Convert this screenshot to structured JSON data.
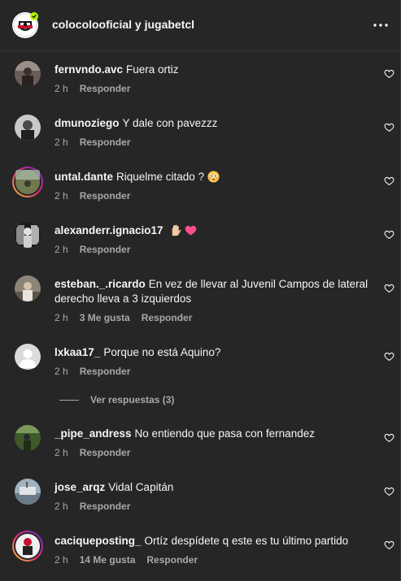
{
  "header": {
    "title": "colocolooficial y jugabetcl",
    "more_icon": "more-horizontal-icon"
  },
  "comments": [
    {
      "user": "fernvndo.avc",
      "text": "Fuera ortiz",
      "time": "2 h",
      "likes": "",
      "reply": "Responder"
    },
    {
      "user": "dmunoziego",
      "text": "Y dale con pavezzz",
      "time": "2 h",
      "likes": "",
      "reply": "Responder"
    },
    {
      "user": "untal.dante",
      "text": "Riquelme citado ?",
      "time": "2 h",
      "likes": "",
      "reply": "Responder"
    },
    {
      "user": "alexanderr.ignacio17",
      "text": "",
      "time": "2 h",
      "likes": "",
      "reply": "Responder"
    },
    {
      "user": "esteban._.ricardo",
      "text": "En vez de llevar al Juvenil Campos de lateral derecho lleva a 3 izquierdos",
      "time": "2 h",
      "likes": "3 Me gusta",
      "reply": "Responder"
    },
    {
      "user": "lxkaa17_",
      "text": "Porque no está Aquino?",
      "time": "2 h",
      "likes": "",
      "reply": "Responder"
    },
    {
      "user": "_pipe_andress",
      "text": "No entiendo que pasa con fernandez",
      "time": "2 h",
      "likes": "",
      "reply": "Responder"
    },
    {
      "user": "jose_arqz",
      "text": "Vidal Capitán",
      "time": "2 h",
      "likes": "",
      "reply": "Responder"
    },
    {
      "user": "caciqueposting_",
      "text": "Ortíz despídete q este es tu último partido",
      "time": "2 h",
      "likes": "14 Me gusta",
      "reply": "Responder"
    }
  ],
  "view_replies": "Ver respuestas (3)",
  "colors": {
    "panel_bg": "#262626",
    "text_primary": "#f5f5f5",
    "text_secondary": "#a8a8a8",
    "story_ring_start": "#f9ce34",
    "story_ring_mid": "#ee2a7b",
    "story_ring_end": "#6228d7"
  }
}
